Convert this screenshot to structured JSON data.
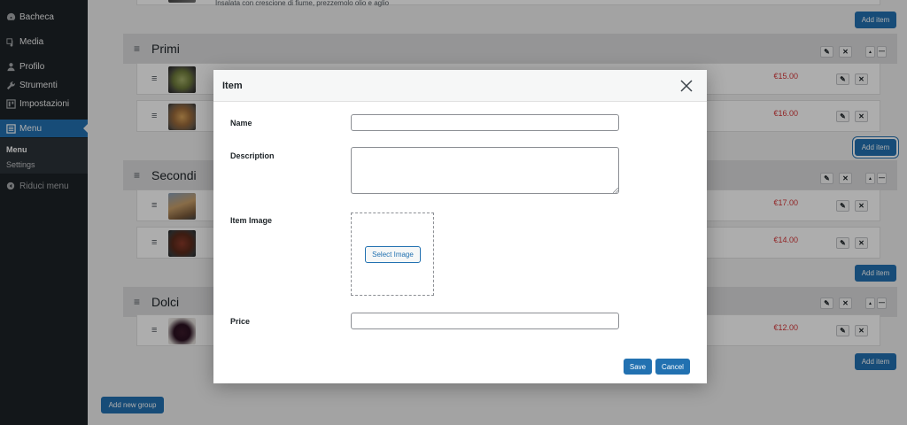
{
  "sidebar": {
    "items": [
      {
        "label": "Bacheca",
        "icon": "dashboard-icon"
      },
      {
        "label": "Media",
        "icon": "media-icon"
      },
      {
        "label": "Profilo",
        "icon": "user-icon"
      },
      {
        "label": "Strumenti",
        "icon": "wrench-icon"
      },
      {
        "label": "Impostazioni",
        "icon": "settings-icon"
      },
      {
        "label": "Menu",
        "icon": "menu-list-icon"
      }
    ],
    "submenu": [
      "Menu",
      "Settings"
    ],
    "collapse_label": "Riduci menu"
  },
  "content": {
    "top_item_text": "Insalata con crescione di fiume, prezzemolo olio e aglio",
    "add_item_label": "Add item",
    "add_group_label": "Add new group",
    "groups": [
      {
        "title": "Primi",
        "items": [
          {
            "price": "€15.00"
          },
          {
            "price": "€16.00"
          }
        ]
      },
      {
        "title": "Secondi",
        "items": [
          {
            "price": "€17.00"
          },
          {
            "price": "€14.00"
          }
        ]
      },
      {
        "title": "Dolci",
        "items": [
          {
            "price": "€12.00"
          }
        ]
      }
    ]
  },
  "icons": {
    "drag": "≡",
    "edit": "✎",
    "delete": "✕",
    "up": "▲",
    "collapse": "—"
  },
  "modal": {
    "title": "Item",
    "fields": {
      "name": {
        "label": "Name",
        "value": ""
      },
      "description": {
        "label": "Description",
        "value": ""
      },
      "image": {
        "label": "Item Image",
        "button": "Select Image"
      },
      "price": {
        "label": "Price",
        "value": ""
      }
    },
    "save_label": "Save",
    "cancel_label": "Cancel"
  },
  "colors": {
    "primary": "#2271b1",
    "sidebar": "#1d2327",
    "price": "#d63638"
  }
}
